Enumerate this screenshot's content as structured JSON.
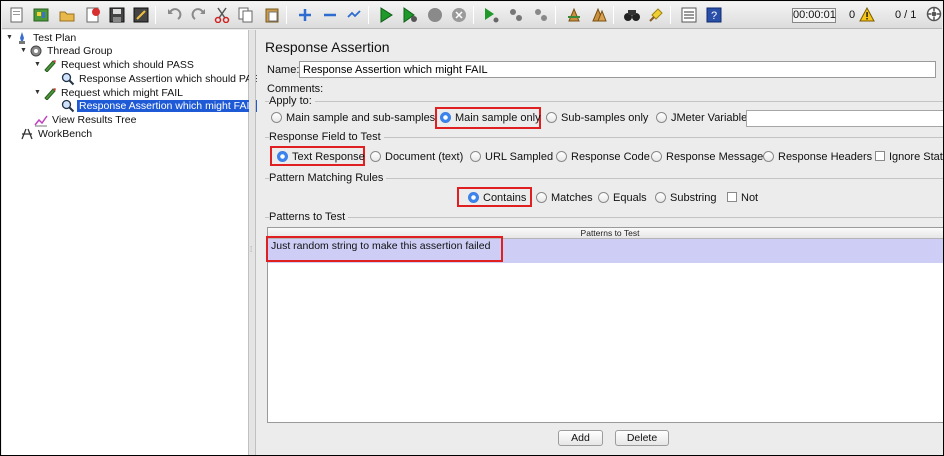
{
  "toolbar": {
    "timer": "00:00:01",
    "error_count": "0",
    "threads": "0 / 1"
  },
  "tree": {
    "items": [
      {
        "label": "Test Plan"
      },
      {
        "label": "Thread Group"
      },
      {
        "label": "Request which should PASS"
      },
      {
        "label": "Response Assertion which should PASS"
      },
      {
        "label": "Request which might FAIL"
      },
      {
        "label": "Response Assertion which might FAIL"
      },
      {
        "label": "View Results Tree"
      },
      {
        "label": "WorkBench"
      }
    ]
  },
  "panel": {
    "title": "Response Assertion",
    "name_label": "Name:",
    "name_value": "Response Assertion which might FAIL",
    "comments_label": "Comments:",
    "apply_to": {
      "title": "Apply to:",
      "options": [
        "Main sample and sub-samples",
        "Main sample only",
        "Sub-samples only",
        "JMeter Variable"
      ],
      "selected": "Main sample only"
    },
    "response_field": {
      "title": "Response Field to Test",
      "options": [
        "Text Response",
        "Document (text)",
        "URL Sampled",
        "Response Code",
        "Response Message",
        "Response Headers"
      ],
      "checkbox": "Ignore Status",
      "selected": "Text Response"
    },
    "pattern_rules": {
      "title": "Pattern Matching Rules",
      "options": [
        "Contains",
        "Matches",
        "Equals",
        "Substring"
      ],
      "checkbox": "Not",
      "selected": "Contains"
    },
    "patterns": {
      "title": "Patterns to Test",
      "column": "Patterns to Test",
      "rows": [
        "Just random string to make this assertion failed"
      ]
    },
    "buttons": {
      "add": "Add",
      "delete": "Delete"
    }
  },
  "colors": {
    "highlight": "#e02020",
    "selection": "#1e5ad6",
    "row_selected": "#cdcdf6"
  }
}
